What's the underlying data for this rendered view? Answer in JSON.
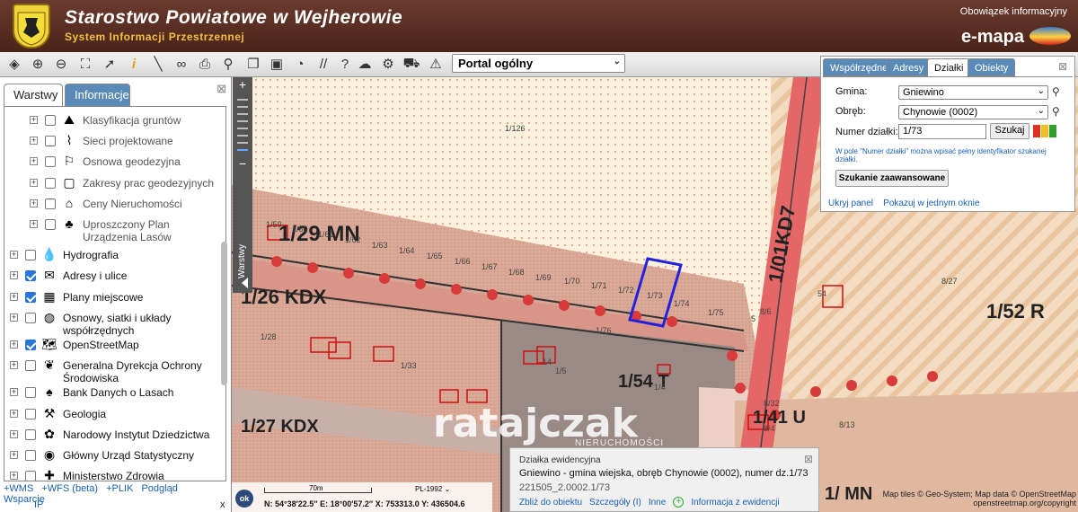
{
  "header": {
    "title": "Starostwo Powiatowe w Wejherowie",
    "subtitle": "System Informacji Przestrzennej",
    "info_link": "Obowiązek informacyjny",
    "brand": "e-mapa"
  },
  "toolbar": {
    "icons": [
      "layers-icon",
      "zoom-in-icon",
      "zoom-out-icon",
      "zoom-extent-icon",
      "pointer-icon",
      "info-icon",
      "measure-icon",
      "link-icon",
      "print-icon",
      "pin-icon",
      "copy-icon",
      "layout-icon",
      "comment-icon",
      "tools-icon",
      "help-icon",
      "cloud-icon",
      "settings-icon",
      "cart-icon",
      "warning-icon"
    ],
    "portal": "Portal ogólny"
  },
  "left_panel": {
    "tabs": [
      "Warstwy",
      "Informacje"
    ],
    "layers": [
      {
        "label": "Klasyfikacja gruntów",
        "checked": false,
        "sub": true,
        "icon": "soil-icon"
      },
      {
        "label": "Sieci projektowane",
        "checked": false,
        "sub": true,
        "icon": "network-icon"
      },
      {
        "label": "Osnowa geodezyjna",
        "checked": false,
        "sub": true,
        "icon": "survey-icon"
      },
      {
        "label": "Zakresy prac geodezyjnych",
        "checked": false,
        "sub": true,
        "icon": "works-icon"
      },
      {
        "label": "Ceny Nieruchomości",
        "checked": false,
        "sub": true,
        "icon": "price-icon"
      },
      {
        "label": "Uproszczony Plan Urządzenia Lasów",
        "checked": false,
        "sub": true,
        "icon": "forest-icon"
      },
      {
        "label": "Hydrografia",
        "checked": false,
        "sub": false,
        "icon": "water-icon"
      },
      {
        "label": "Adresy i ulice",
        "checked": true,
        "sub": false,
        "icon": "address-icon"
      },
      {
        "label": "Plany miejscowe",
        "checked": true,
        "sub": false,
        "icon": "plan-icon"
      },
      {
        "label": "Osnowy, siatki i układy współrzędnych",
        "checked": false,
        "sub": false,
        "icon": "globe-icon"
      },
      {
        "label": "OpenStreetMap",
        "checked": true,
        "sub": false,
        "icon": "osm-icon"
      },
      {
        "label": "Generalna Dyrekcja Ochrony Środowiska",
        "checked": false,
        "sub": false,
        "icon": "leaf-icon"
      },
      {
        "label": "Bank Danych o Lasach",
        "checked": false,
        "sub": false,
        "icon": "tree-icon"
      },
      {
        "label": "Geologia",
        "checked": false,
        "sub": false,
        "icon": "pick-icon"
      },
      {
        "label": "Narodowy Instytut Dziedzictwa",
        "checked": false,
        "sub": false,
        "icon": "heritage-icon"
      },
      {
        "label": "Główny Urząd Statystyczny",
        "checked": false,
        "sub": false,
        "icon": "stats-icon"
      },
      {
        "label": "Ministerstwo Zdrowia",
        "checked": false,
        "sub": false,
        "icon": "health-icon"
      }
    ],
    "links": [
      "+WMS",
      "+WFS (beta)",
      "+PLIK",
      "Podgląd",
      "Wsparcie"
    ],
    "ip": "IP",
    "close_x": "x"
  },
  "map_nav": {
    "tab": "Warstwy"
  },
  "map_labels": {
    "zones": [
      "1/29 MN",
      "1/26 KDX",
      "1/54 T",
      "1/27 KDX",
      "1/41 U",
      "1/52 R",
      "1/01KD7",
      "1/ MN"
    ],
    "parcels": [
      "1/126",
      "1/59",
      "1/60",
      "1/61",
      "1/62",
      "1/63",
      "1/64",
      "1/65",
      "1/66",
      "1/67",
      "1/68",
      "1/69",
      "1/70",
      "1/71",
      "1/72",
      "1/73",
      "1/74",
      "1/75",
      "1/76",
      "1/28",
      "1/5",
      "1/4",
      "1/33",
      "8/27",
      "8/6",
      "8/32",
      "8/13",
      "8/4",
      "5",
      "14",
      "54"
    ]
  },
  "search_panel": {
    "tabs": [
      "Współrzędne",
      "Adresy",
      "Działki",
      "Obiekty"
    ],
    "active_tab": "Działki",
    "gmina_label": "Gmina:",
    "gmina_value": "Gniewino",
    "obreb_label": "Obręb:",
    "obreb_value": "Chynowie (0002)",
    "numer_label": "Numer działki:",
    "numer_value": "1/73",
    "search_button": "Szukaj",
    "hint": "W pole \"Numer działki\" można wpisać pełny identyfikator szukanej działki.",
    "advanced_button": "Szukanie zaawansowane",
    "hide_link": "Ukryj panel",
    "window_link": "Pokazuj w jednym oknie",
    "colors": [
      "#e03020",
      "#f0c020",
      "#30a030"
    ]
  },
  "popup": {
    "title": "Działka ewidencyjna",
    "main": "Gniewino - gmina wiejska, obręb Chynowie (0002), numer dz.1/73",
    "id": "221505_2.0002.1/73",
    "actions": [
      "Zbliż do obiektu",
      "Szczegóły (I)",
      "Inne",
      "Informacja z ewidencji"
    ]
  },
  "status": {
    "ok": "ok",
    "scale": "70m",
    "crs": "PL-1992",
    "coords": "N: 54°38′22.5″  E: 18°00′57.2″  X: 753313.0  Y: 436504.6"
  },
  "attribution": [
    "Map tiles © Geo-System; Map data © OpenStreetMap",
    "openstreetmap.org/copyright"
  ],
  "watermark": {
    "brand": "ratajczak",
    "sub": "NIERUCHOMOŚCI"
  }
}
